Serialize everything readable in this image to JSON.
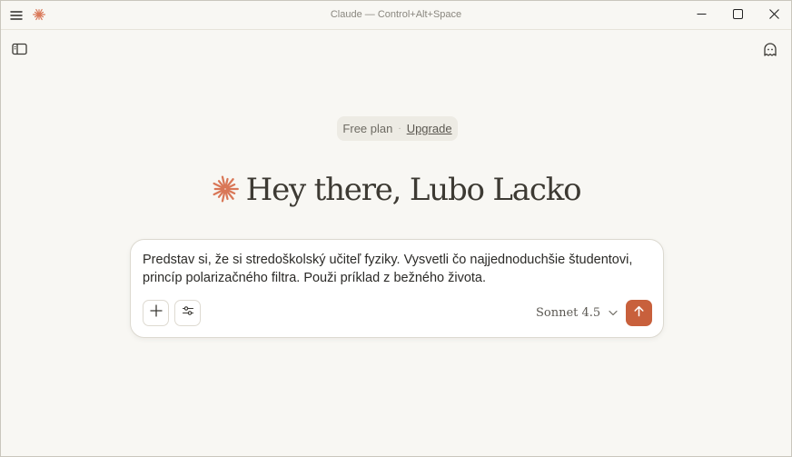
{
  "window": {
    "title": "Claude — Control+Alt+Space"
  },
  "plan": {
    "label": "Free plan",
    "separator": "·",
    "upgrade_label": "Upgrade"
  },
  "greeting": {
    "text": "Hey there, Lubo Lacko"
  },
  "composer": {
    "input_value": "Predstav si, že si stredoškolský učiteľ fyziky. Vysvetli čo najjednoduchšie študentovi, princíp polarizačného filtra. Použi príklad z bežného života.",
    "model_label": "Sonnet 4.5"
  },
  "icons": {
    "menu": "hamburger-menu-icon",
    "logo": "claude-starburst-icon",
    "minimize": "minimize-icon",
    "maximize": "maximize-icon",
    "close": "close-icon",
    "sidebar": "sidebar-toggle-icon",
    "incognito": "ghost-icon",
    "add": "plus-icon",
    "tools": "sliders-icon",
    "chevron": "chevron-down-icon",
    "send": "arrow-up-icon"
  },
  "colors": {
    "accent": "#d97757",
    "send_button": "#c8603c",
    "background": "#f8f7f3"
  }
}
